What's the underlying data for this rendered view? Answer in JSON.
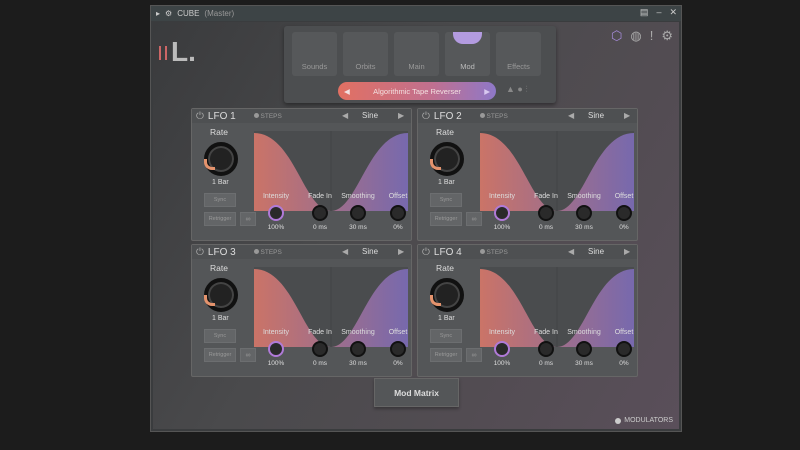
{
  "window": {
    "title": "CUBE",
    "subtitle": "(Master)"
  },
  "logo": "L.",
  "nav": {
    "tabs": [
      "Sounds",
      "Orbits",
      "Main",
      "Mod",
      "Effects"
    ],
    "active": "Mod",
    "preset": "Algorithmic Tape Reverser"
  },
  "lfos": [
    {
      "name": "LFO 1",
      "steps": "STEPS",
      "shape": "Sine",
      "rate_label": "Rate",
      "rate": "1 Bar",
      "sync": "Sync",
      "retrigger": "Retrigger",
      "params": [
        {
          "label": "Intensity",
          "value": "100%"
        },
        {
          "label": "Fade In",
          "value": "0 ms"
        },
        {
          "label": "Smoothing",
          "value": "30 ms"
        },
        {
          "label": "Offset",
          "value": "0%"
        }
      ]
    },
    {
      "name": "LFO 2",
      "steps": "STEPS",
      "shape": "Sine",
      "rate_label": "Rate",
      "rate": "1 Bar",
      "sync": "Sync",
      "retrigger": "Retrigger",
      "params": [
        {
          "label": "Intensity",
          "value": "100%"
        },
        {
          "label": "Fade In",
          "value": "0 ms"
        },
        {
          "label": "Smoothing",
          "value": "30 ms"
        },
        {
          "label": "Offset",
          "value": "0%"
        }
      ]
    },
    {
      "name": "LFO 3",
      "steps": "STEPS",
      "shape": "Sine",
      "rate_label": "Rate",
      "rate": "1 Bar",
      "sync": "Sync",
      "retrigger": "Retrigger",
      "params": [
        {
          "label": "Intensity",
          "value": "100%"
        },
        {
          "label": "Fade In",
          "value": "0 ms"
        },
        {
          "label": "Smoothing",
          "value": "30 ms"
        },
        {
          "label": "Offset",
          "value": "0%"
        }
      ]
    },
    {
      "name": "LFO 4",
      "steps": "STEPS",
      "shape": "Sine",
      "rate_label": "Rate",
      "rate": "1 Bar",
      "sync": "Sync",
      "retrigger": "Retrigger",
      "params": [
        {
          "label": "Intensity",
          "value": "100%"
        },
        {
          "label": "Fade In",
          "value": "0 ms"
        },
        {
          "label": "Smoothing",
          "value": "30 ms"
        },
        {
          "label": "Offset",
          "value": "0%"
        }
      ]
    }
  ],
  "mod_matrix": "Mod Matrix",
  "modulators": "MODULATORS"
}
